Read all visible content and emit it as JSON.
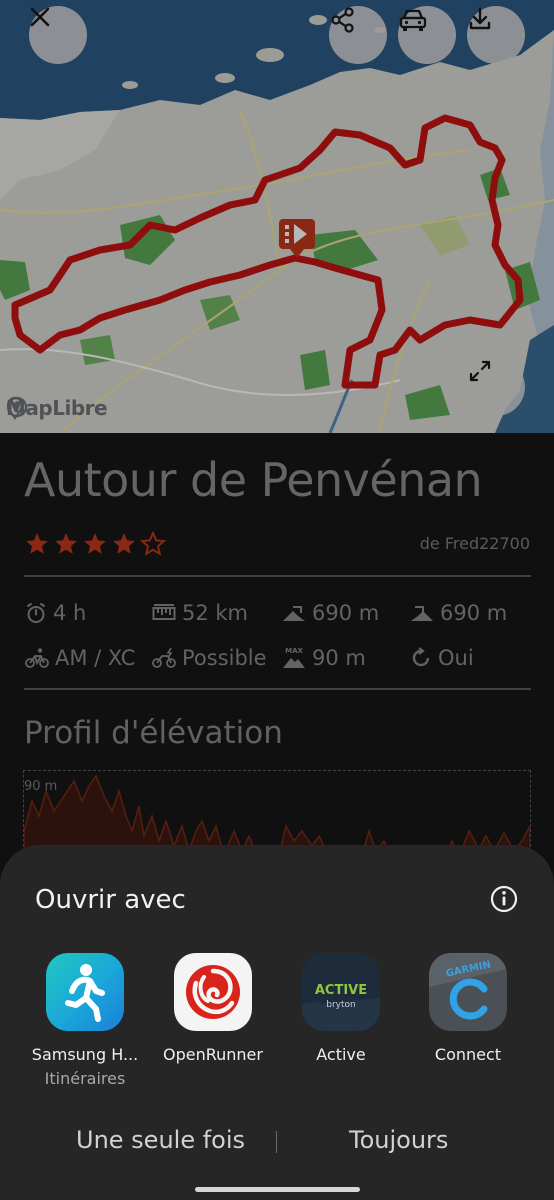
{
  "map": {
    "attribution": "MapLibre",
    "close_icon": "close-icon",
    "share_icon": "share-icon",
    "car_icon": "car-icon",
    "download_icon": "download-icon",
    "expand_icon": "fullscreen-icon",
    "start_marker_icon": "route-start-icon",
    "route_color": "#c51212"
  },
  "route": {
    "title": "Autour de Penvénan",
    "rating": 4,
    "rating_max": 5,
    "author": "de Fred22700",
    "stats": {
      "duration": "4 h",
      "distance": "52 km",
      "ascent": "690 m",
      "descent": "690 m",
      "bike_type": "AM / XC",
      "ebike": "Possible",
      "max_altitude_badge": "MAX",
      "max_altitude": "90 m",
      "loop": "Oui"
    },
    "elevation_title": "Profil d'élévation",
    "elevation_max_label": "90 m"
  },
  "sheet": {
    "title": "Ouvrir avec",
    "info_icon": "info-icon",
    "apps": [
      {
        "label": "Samsung H...",
        "sub": "Itinéraires",
        "icon": "samsung-health-icon"
      },
      {
        "label": "OpenRunner",
        "sub": "",
        "icon": "openrunner-icon"
      },
      {
        "label": "Active",
        "sub": "",
        "icon": "bryton-active-icon",
        "icon_text": "ACTIVE",
        "icon_subtext": "bryton"
      },
      {
        "label": "Connect",
        "sub": "",
        "icon": "garmin-connect-icon",
        "icon_text": "GARMIN"
      }
    ],
    "once_label": "Une seule fois",
    "always_label": "Toujours"
  },
  "colors": {
    "background": "#171717",
    "sheet": "#262626",
    "accent_red": "#c0381b"
  }
}
